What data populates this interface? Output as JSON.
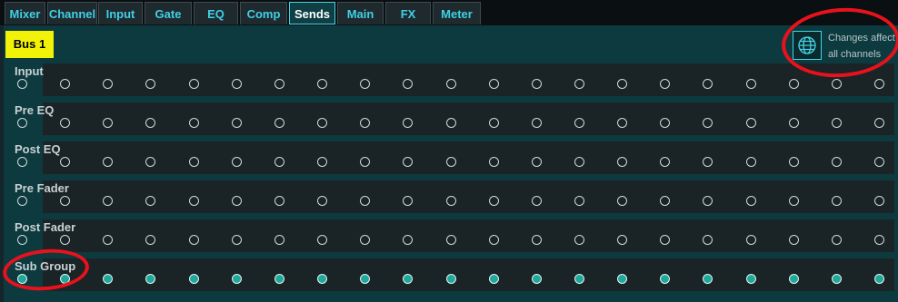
{
  "tabs": [
    {
      "label": "Mixer",
      "active": false
    },
    {
      "label": "Channel",
      "active": false
    },
    {
      "label": "Input",
      "active": false
    },
    {
      "label": "Gate",
      "active": false
    },
    {
      "label": "EQ",
      "active": false
    },
    {
      "label": "Comp",
      "active": false
    },
    {
      "label": "Sends",
      "active": true
    },
    {
      "label": "Main",
      "active": false
    },
    {
      "label": "FX",
      "active": false
    },
    {
      "label": "Meter",
      "active": false
    }
  ],
  "bus_label": "Bus 1",
  "global_toggle": {
    "icon": "globe-icon",
    "text_line1": "Changes affect",
    "text_line2": "all channels"
  },
  "tap_points": [
    {
      "label": "Input",
      "selected": false
    },
    {
      "label": "Pre EQ",
      "selected": false
    },
    {
      "label": "Post EQ",
      "selected": false
    },
    {
      "label": "Pre Fader",
      "selected": false
    },
    {
      "label": "Post Fader",
      "selected": false
    },
    {
      "label": "Sub Group",
      "selected": true
    }
  ],
  "channel_count": 21,
  "colors": {
    "accent": "#46d3e6",
    "bus_badge": "#f2f208",
    "led_on": "#1fa99b",
    "highlight_ring": "#e8121c"
  }
}
